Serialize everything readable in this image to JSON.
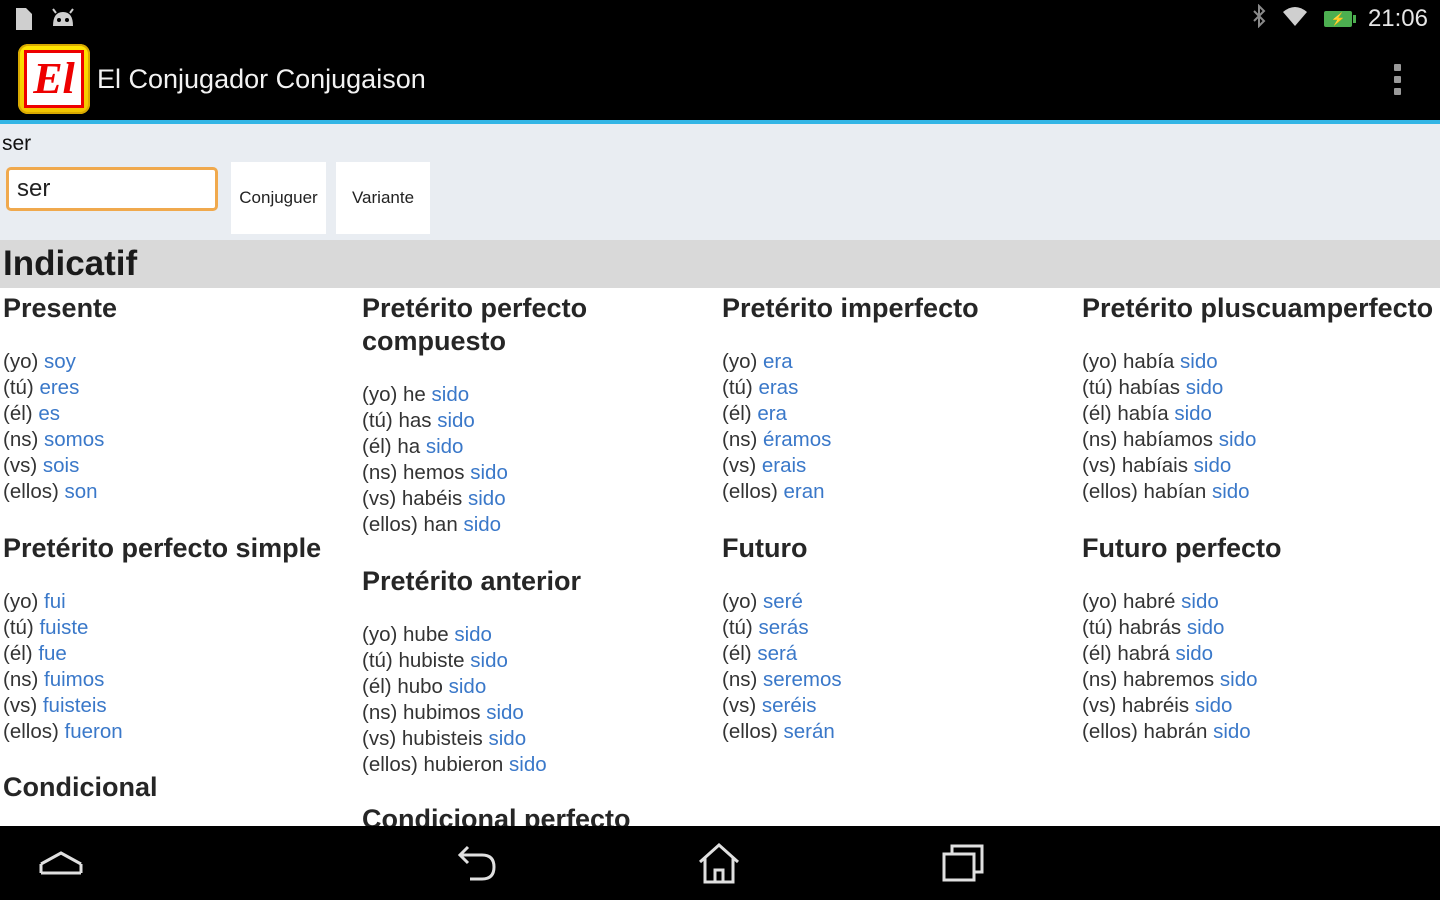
{
  "status_bar": {
    "time": "21:06",
    "left_icons": [
      "sd-card-icon",
      "android-icon"
    ],
    "right_icons": [
      "bluetooth-icon",
      "wifi-icon",
      "battery-charging-icon"
    ]
  },
  "action_bar": {
    "app_icon_text": "El",
    "title": "El Conjugador Conjugaison",
    "overflow_icon": "overflow-menu-icon"
  },
  "search": {
    "label": "ser",
    "input_value": "ser",
    "conjuguer_label": "Conjuguer",
    "variante_label": "Variante"
  },
  "mood": "Indicatif",
  "tenses": [
    {
      "name": "Presente",
      "forms": [
        {
          "pronoun": "(yo)",
          "aux": "",
          "verb": "soy"
        },
        {
          "pronoun": "(tú)",
          "aux": "",
          "verb": "eres"
        },
        {
          "pronoun": "(él)",
          "aux": "",
          "verb": "es"
        },
        {
          "pronoun": "(ns)",
          "aux": "",
          "verb": "somos"
        },
        {
          "pronoun": "(vs)",
          "aux": "",
          "verb": "sois"
        },
        {
          "pronoun": "(ellos)",
          "aux": "",
          "verb": "son"
        }
      ]
    },
    {
      "name": "Pretérito perfecto compuesto",
      "forms": [
        {
          "pronoun": "(yo)",
          "aux": "he",
          "verb": "sido"
        },
        {
          "pronoun": "(tú)",
          "aux": "has",
          "verb": "sido"
        },
        {
          "pronoun": "(él)",
          "aux": "ha",
          "verb": "sido"
        },
        {
          "pronoun": "(ns)",
          "aux": "hemos",
          "verb": "sido"
        },
        {
          "pronoun": "(vs)",
          "aux": "habéis",
          "verb": "sido"
        },
        {
          "pronoun": "(ellos)",
          "aux": "han",
          "verb": "sido"
        }
      ]
    },
    {
      "name": "Pretérito imperfecto",
      "forms": [
        {
          "pronoun": "(yo)",
          "aux": "",
          "verb": "era"
        },
        {
          "pronoun": "(tú)",
          "aux": "",
          "verb": "eras"
        },
        {
          "pronoun": "(él)",
          "aux": "",
          "verb": "era"
        },
        {
          "pronoun": "(ns)",
          "aux": "",
          "verb": "éramos"
        },
        {
          "pronoun": "(vs)",
          "aux": "",
          "verb": "erais"
        },
        {
          "pronoun": "(ellos)",
          "aux": "",
          "verb": "eran"
        }
      ]
    },
    {
      "name": "Pretérito pluscuamperfecto",
      "forms": [
        {
          "pronoun": "(yo)",
          "aux": "había",
          "verb": "sido"
        },
        {
          "pronoun": "(tú)",
          "aux": "habías",
          "verb": "sido"
        },
        {
          "pronoun": "(él)",
          "aux": "había",
          "verb": "sido"
        },
        {
          "pronoun": "(ns)",
          "aux": "habíamos",
          "verb": "sido"
        },
        {
          "pronoun": "(vs)",
          "aux": "habíais",
          "verb": "sido"
        },
        {
          "pronoun": "(ellos)",
          "aux": "habían",
          "verb": "sido"
        }
      ]
    },
    {
      "name": "Pretérito perfecto simple",
      "forms": [
        {
          "pronoun": "(yo)",
          "aux": "",
          "verb": "fui"
        },
        {
          "pronoun": "(tú)",
          "aux": "",
          "verb": "fuiste"
        },
        {
          "pronoun": "(él)",
          "aux": "",
          "verb": "fue"
        },
        {
          "pronoun": "(ns)",
          "aux": "",
          "verb": "fuimos"
        },
        {
          "pronoun": "(vs)",
          "aux": "",
          "verb": "fuisteis"
        },
        {
          "pronoun": "(ellos)",
          "aux": "",
          "verb": "fueron"
        }
      ]
    },
    {
      "name": "Pretérito anterior",
      "forms": [
        {
          "pronoun": "(yo)",
          "aux": "hube",
          "verb": "sido"
        },
        {
          "pronoun": "(tú)",
          "aux": "hubiste",
          "verb": "sido"
        },
        {
          "pronoun": "(él)",
          "aux": "hubo",
          "verb": "sido"
        },
        {
          "pronoun": "(ns)",
          "aux": "hubimos",
          "verb": "sido"
        },
        {
          "pronoun": "(vs)",
          "aux": "hubisteis",
          "verb": "sido"
        },
        {
          "pronoun": "(ellos)",
          "aux": "hubieron",
          "verb": "sido"
        }
      ]
    },
    {
      "name": "Futuro",
      "forms": [
        {
          "pronoun": "(yo)",
          "aux": "",
          "verb": "seré"
        },
        {
          "pronoun": "(tú)",
          "aux": "",
          "verb": "serás"
        },
        {
          "pronoun": "(él)",
          "aux": "",
          "verb": "será"
        },
        {
          "pronoun": "(ns)",
          "aux": "",
          "verb": "seremos"
        },
        {
          "pronoun": "(vs)",
          "aux": "",
          "verb": "seréis"
        },
        {
          "pronoun": "(ellos)",
          "aux": "",
          "verb": "serán"
        }
      ]
    },
    {
      "name": "Futuro perfecto",
      "forms": [
        {
          "pronoun": "(yo)",
          "aux": "habré",
          "verb": "sido"
        },
        {
          "pronoun": "(tú)",
          "aux": "habrás",
          "verb": "sido"
        },
        {
          "pronoun": "(él)",
          "aux": "habrá",
          "verb": "sido"
        },
        {
          "pronoun": "(ns)",
          "aux": "habremos",
          "verb": "sido"
        },
        {
          "pronoun": "(vs)",
          "aux": "habréis",
          "verb": "sido"
        },
        {
          "pronoun": "(ellos)",
          "aux": "habrán",
          "verb": "sido"
        }
      ]
    },
    {
      "name": "Condicional",
      "forms": []
    },
    {
      "name": "Condicional perfecto",
      "forms": []
    }
  ],
  "nav_bar": {
    "buttons": [
      "collapse-icon",
      "back-icon",
      "home-icon",
      "recent-apps-icon"
    ]
  },
  "colors": {
    "accent": "#33b5e5",
    "verb_link": "#3a78c9",
    "input_border": "#f0a94d",
    "mood_header_bg": "#d9d9d9",
    "search_panel_bg": "#e9edf2"
  }
}
